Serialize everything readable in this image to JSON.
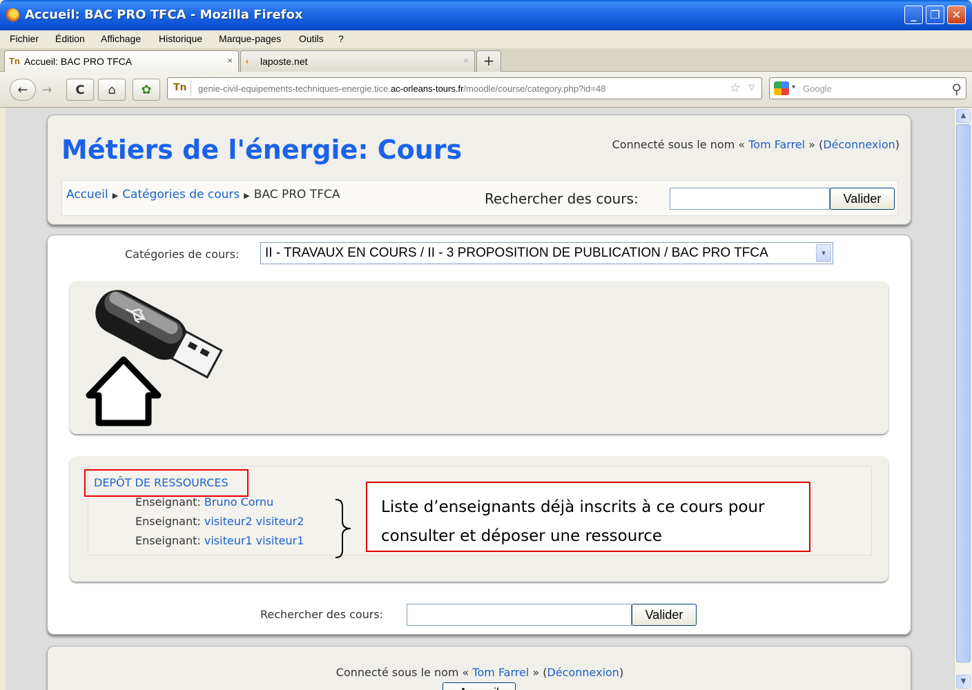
{
  "window": {
    "title": "Accueil: BAC PRO TFCA - Mozilla Firefox",
    "min_label": "_",
    "max_label": "❐",
    "close_label": "✕"
  },
  "menu": [
    "Fichier",
    "Édition",
    "Affichage",
    "Historique",
    "Marque-pages",
    "Outils",
    "?"
  ],
  "tabs": [
    {
      "label": "Accueil: BAC PRO TFCA",
      "close": "×",
      "favicon": "Tn"
    },
    {
      "label": "laposte.net",
      "close": "×",
      "favicon": "◐"
    }
  ],
  "newtab_label": "+",
  "nav": {
    "back": "←",
    "forward": "→",
    "reload": "C",
    "home": "⌂",
    "addon": "✿"
  },
  "url": {
    "prefix": "genie-civil-equipements-techniques-energie.tice.",
    "domain": "ac-orleans-tours.fr",
    "path": "/moodle/course/category.php?id=48",
    "favicon": "Tn",
    "star": "☆",
    "drop": "▽"
  },
  "search_engine": {
    "placeholder": "Google",
    "drop": "▾",
    "mag": "⚲"
  },
  "scrollbar": {
    "up": "▲",
    "down": "▼"
  },
  "header": {
    "site_title": "Métiers de l'énergie: Cours",
    "login_prefix": "Connecté sous le nom « ",
    "user_name": "Tom Farrel",
    "login_mid": " » (",
    "logout": "Déconnexion",
    "login_suffix": ")",
    "breadcrumb": [
      "Accueil",
      "Catégories de cours",
      "BAC PRO TFCA"
    ],
    "bc_sep": "▶",
    "search_label": "Rechercher des cours:",
    "search_button": "Valider"
  },
  "category": {
    "label": "Catégories de cours:",
    "selected": "II - TRAVAUX EN COURS / II - 3 PROPOSITION DE PUBLICATION / BAC PRO TFCA",
    "arrow": "▾"
  },
  "course": {
    "title": "DEPÔT DE RESSOURCES",
    "teachers": [
      {
        "role": "Enseignant: ",
        "name": "Bruno Cornu"
      },
      {
        "role": "Enseignant: ",
        "name": "visiteur2 visiteur2"
      },
      {
        "role": "Enseignant: ",
        "name": "visiteur1 visiteur1"
      }
    ],
    "callout_line1": "Liste d’enseignants déjà inscrits à ce cours pour",
    "callout_line2": "consulter et déposer une ressource"
  },
  "bottom_search": {
    "label": "Rechercher des cours:",
    "button": "Valider"
  },
  "footer": {
    "login_prefix": "Connecté sous le nom « ",
    "user_name": "Tom Farrel",
    "login_mid": " » (",
    "logout": "Déconnexion",
    "login_suffix": ")",
    "home_button": "Accueil"
  }
}
